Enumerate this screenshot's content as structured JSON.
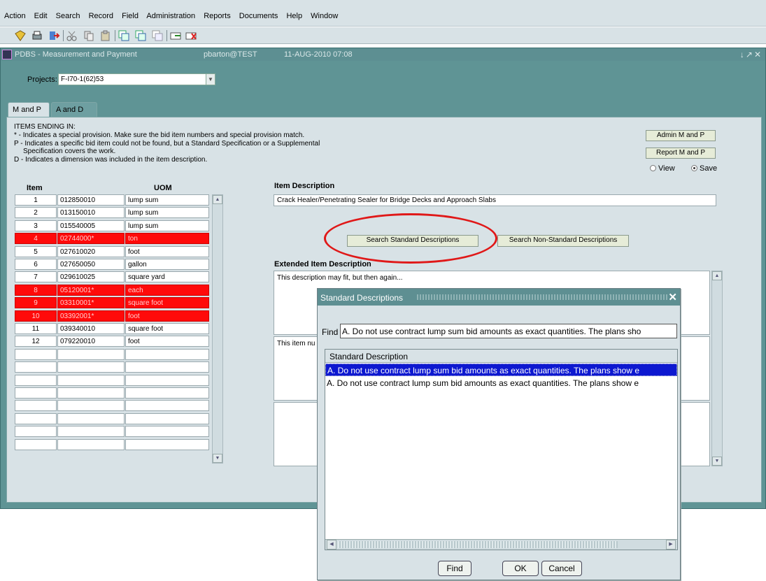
{
  "menu": [
    "Action",
    "Edit",
    "Search",
    "Record",
    "Field",
    "Administration",
    "Reports",
    "Documents",
    "Help",
    "Window"
  ],
  "toolbar_icons": [
    "save-icon",
    "print-icon",
    "exit-icon",
    "cut-icon",
    "copy-icon",
    "paste-icon",
    "insert-record-icon",
    "delete-record-icon",
    "clear-record-icon",
    "new-record-icon",
    "remove-record-icon"
  ],
  "window": {
    "title": "PDBS - Measurement and Payment",
    "user": "pbarton@TEST",
    "datetime": "11-AUG-2010 07:08",
    "controls": "↓↗✕"
  },
  "project": {
    "label": "Projects:",
    "value": "F-I70-1(62)53"
  },
  "tabs": [
    {
      "label": "M and P"
    },
    {
      "label": "A and D"
    }
  ],
  "legend": {
    "title": "ITEMS ENDING IN:",
    "star": "* - Indicates a special provision.  Make sure the bid item numbers and special provision match.",
    "p1": "P - Indicates a specific bid item could not be found, but a Standard Specification or a Supplemental",
    "p2": "Specification covers the work.",
    "d": "D - Indicates a dimension was included in the item description."
  },
  "buttons": {
    "admin": "Admin M and P",
    "report": "Report M and P",
    "search_std": "Search Standard Descriptions",
    "search_nonstd": "Search Non-Standard Descriptions"
  },
  "mode": {
    "view": "View",
    "save": "Save",
    "selected": "save"
  },
  "grid": {
    "headers": {
      "item": "Item",
      "uom": "UOM"
    },
    "rows": [
      {
        "num": "1",
        "code": "012850010",
        "uom": "lump sum",
        "flag": false
      },
      {
        "num": "2",
        "code": "013150010",
        "uom": "lump sum",
        "flag": false
      },
      {
        "num": "3",
        "code": "015540005",
        "uom": "lump sum",
        "flag": false
      },
      {
        "num": "4",
        "code": "02744000*",
        "uom": "ton",
        "flag": true
      },
      {
        "num": "5",
        "code": "027610020",
        "uom": "foot",
        "flag": false
      },
      {
        "num": "6",
        "code": "027650050",
        "uom": "gallon",
        "flag": false
      },
      {
        "num": "7",
        "code": "029610025",
        "uom": "square yard",
        "flag": false
      },
      {
        "num": "8",
        "code": "05120001*",
        "uom": "each",
        "flag": true
      },
      {
        "num": "9",
        "code": "03310001*",
        "uom": "square foot",
        "flag": true
      },
      {
        "num": "10",
        "code": "03392001*",
        "uom": "foot",
        "flag": true
      },
      {
        "num": "11",
        "code": "039340010",
        "uom": "square foot",
        "flag": false
      },
      {
        "num": "12",
        "code": "079220010",
        "uom": "foot",
        "flag": false
      }
    ],
    "empty_rows": 8
  },
  "item_description": {
    "label": "Item Description",
    "value": "Crack Healer/Penetrating Sealer for Bridge Decks and Approach Slabs"
  },
  "extended": {
    "label": "Extended Item Description",
    "text1": "This description may fit, but then again...",
    "text2": "This item nu"
  },
  "dialog": {
    "title": "Standard Descriptions",
    "close": "✕",
    "find_label": "Find",
    "find_value": "A. Do not use contract lump sum bid amounts as exact quantities.  The plans sho",
    "list_header": "Standard Description",
    "rows": [
      "A. Do not use contract lump sum bid amounts as exact quantities.  The plans show e",
      "A. Do not use contract lump sum bid amounts as exact quantities.  The plans show e"
    ],
    "selected_index": 0,
    "buttons": {
      "find": "Find",
      "ok": "OK",
      "cancel": "Cancel"
    }
  }
}
